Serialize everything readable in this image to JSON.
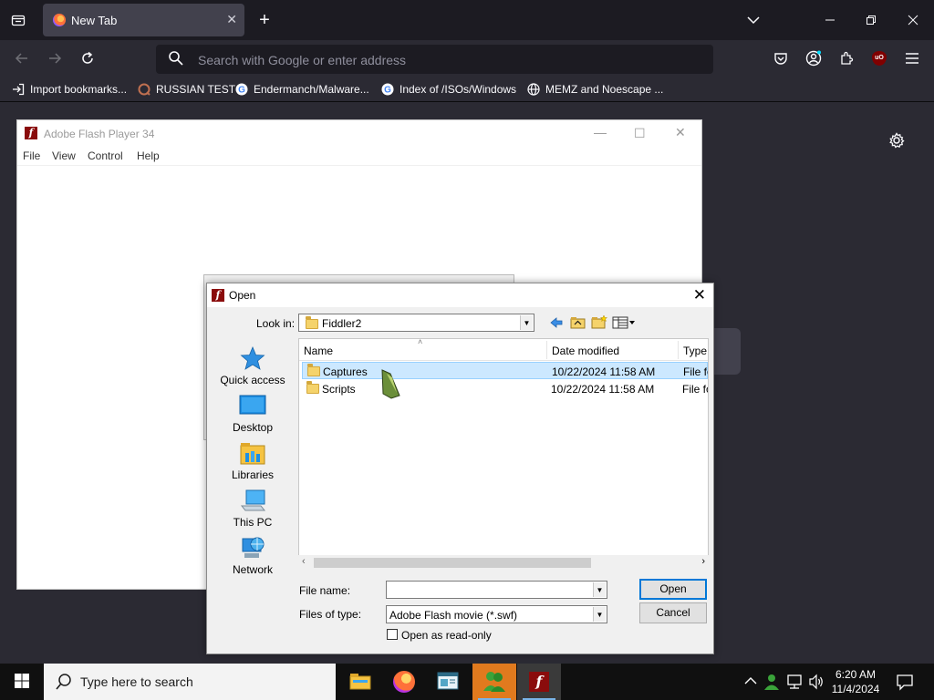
{
  "browser": {
    "tab_title": "New Tab",
    "url_placeholder": "Search with Google or enter address",
    "bookmarks": [
      {
        "label": "Import bookmarks...",
        "icon": "import-icon"
      },
      {
        "label": "RUSSIAN TEST",
        "icon": "site-icon"
      },
      {
        "label": "Endermanch/Malware...",
        "icon": "google-icon"
      },
      {
        "label": "Index of /ISOs/Windows",
        "icon": "google-icon"
      },
      {
        "label": "MEMZ and Noescape ...",
        "icon": "globe-icon"
      }
    ],
    "ublock_badge": "uO"
  },
  "flash_window": {
    "title": "Adobe Flash Player 34",
    "menu": [
      "File",
      "View",
      "Control",
      "Help"
    ]
  },
  "open_dialog": {
    "title": "Open",
    "look_in_label": "Look in:",
    "look_in_value": "Fiddler2",
    "places": [
      {
        "label": "Quick access",
        "icon": "star-icon"
      },
      {
        "label": "Desktop",
        "icon": "desktop-icon"
      },
      {
        "label": "Libraries",
        "icon": "libraries-icon"
      },
      {
        "label": "This PC",
        "icon": "computer-icon"
      },
      {
        "label": "Network",
        "icon": "network-icon"
      }
    ],
    "columns": [
      "Name",
      "Date modified",
      "Type"
    ],
    "files": [
      {
        "name": "Captures",
        "date": "10/22/2024 11:58 AM",
        "type": "File fo",
        "selected": true
      },
      {
        "name": "Scripts",
        "date": "10/22/2024 11:58 AM",
        "type": "File fo",
        "selected": false
      }
    ],
    "file_name_label": "File name:",
    "file_name_value": "",
    "files_of_type_label": "Files of type:",
    "files_of_type_value": "Adobe Flash movie (*.swf)",
    "read_only_label": "Open as read-only",
    "open_button": "Open",
    "cancel_button": "Cancel"
  },
  "taskbar": {
    "search_placeholder": "Type here to search",
    "time": "6:20 AM",
    "date": "11/4/2024"
  },
  "colors": {
    "firefox_dark": "#1c1b22",
    "firefox_toolbar": "#2b2a33",
    "selection": "#cce8ff",
    "accent": "#0078d7",
    "flash_red": "#8a0c0c"
  }
}
